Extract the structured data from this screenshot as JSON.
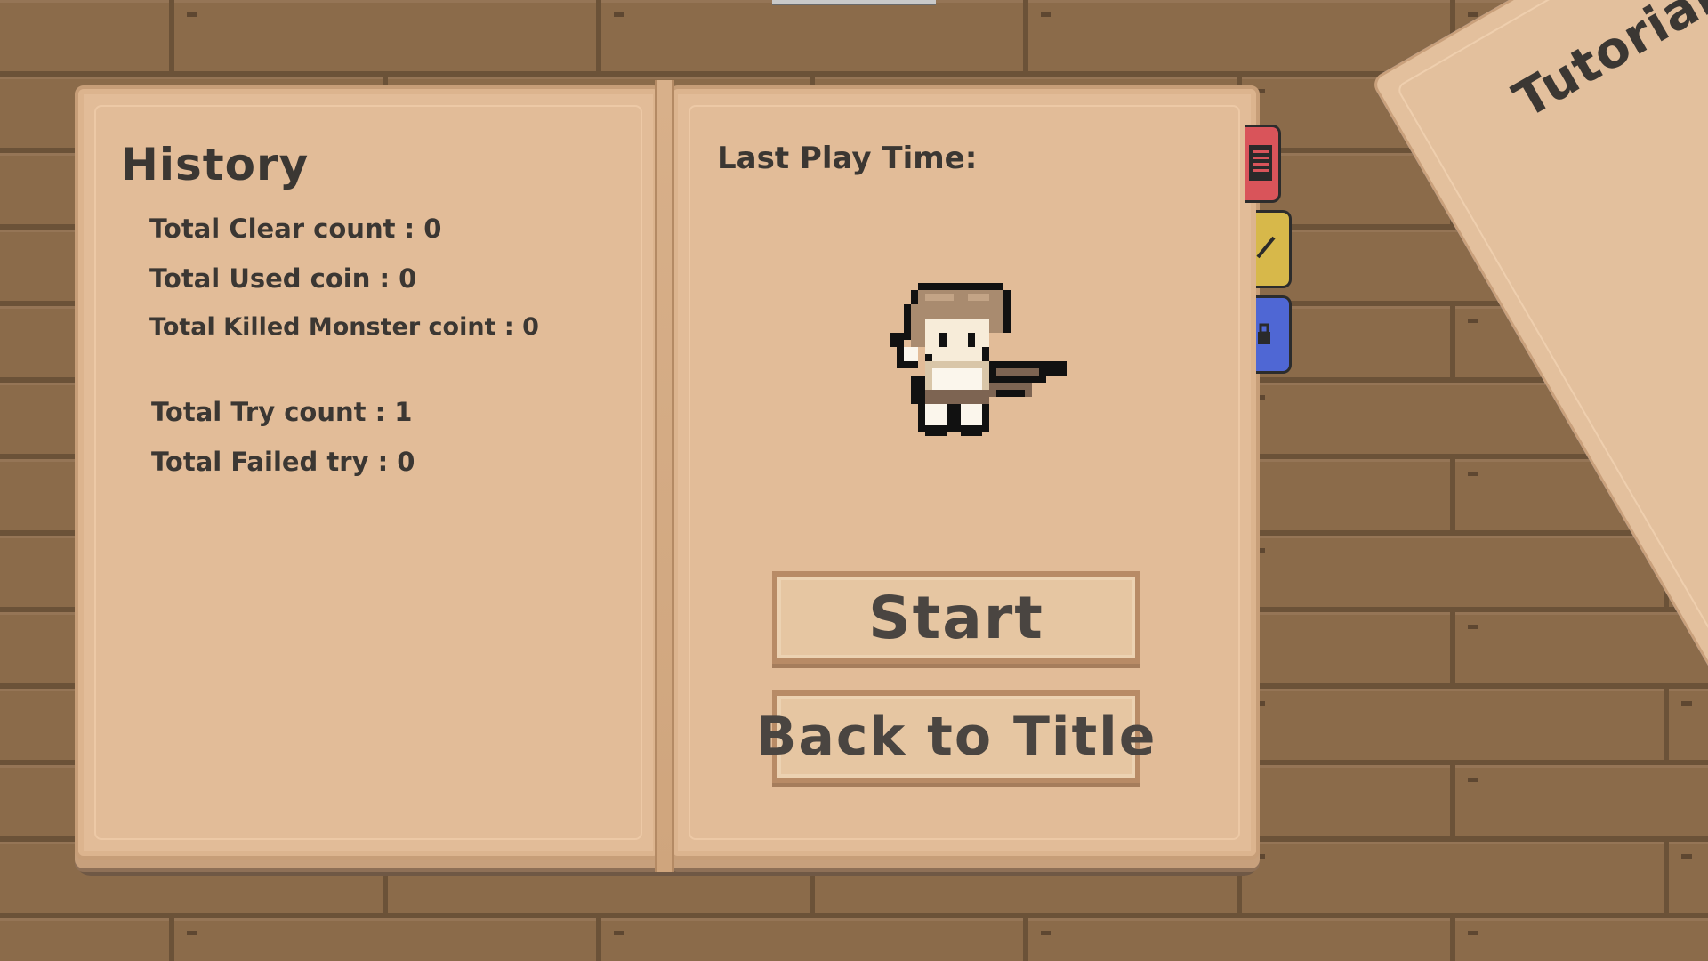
{
  "history": {
    "title": "History",
    "stats": [
      "Total Clear count : 0",
      "Total Used coin : 0",
      "Total Killed Monster coint : 0",
      "Total Try count : 1",
      "Total Failed try : 0"
    ]
  },
  "play": {
    "last_play_time_label": "Last Play Time:"
  },
  "buttons": {
    "start": "Start",
    "back_to_title": "Back to Title"
  },
  "tabs": [
    {
      "icon": "document-icon",
      "color": "#d9545a"
    },
    {
      "icon": "pencil-icon",
      "color": "#d7b84a"
    },
    {
      "icon": "lock-icon",
      "color": "#4f67d4"
    }
  ],
  "tutorial": {
    "title": "Tutorial"
  },
  "colors": {
    "wood": "#8b6b4a",
    "page": "#e2bc98",
    "text": "#3b3733"
  }
}
